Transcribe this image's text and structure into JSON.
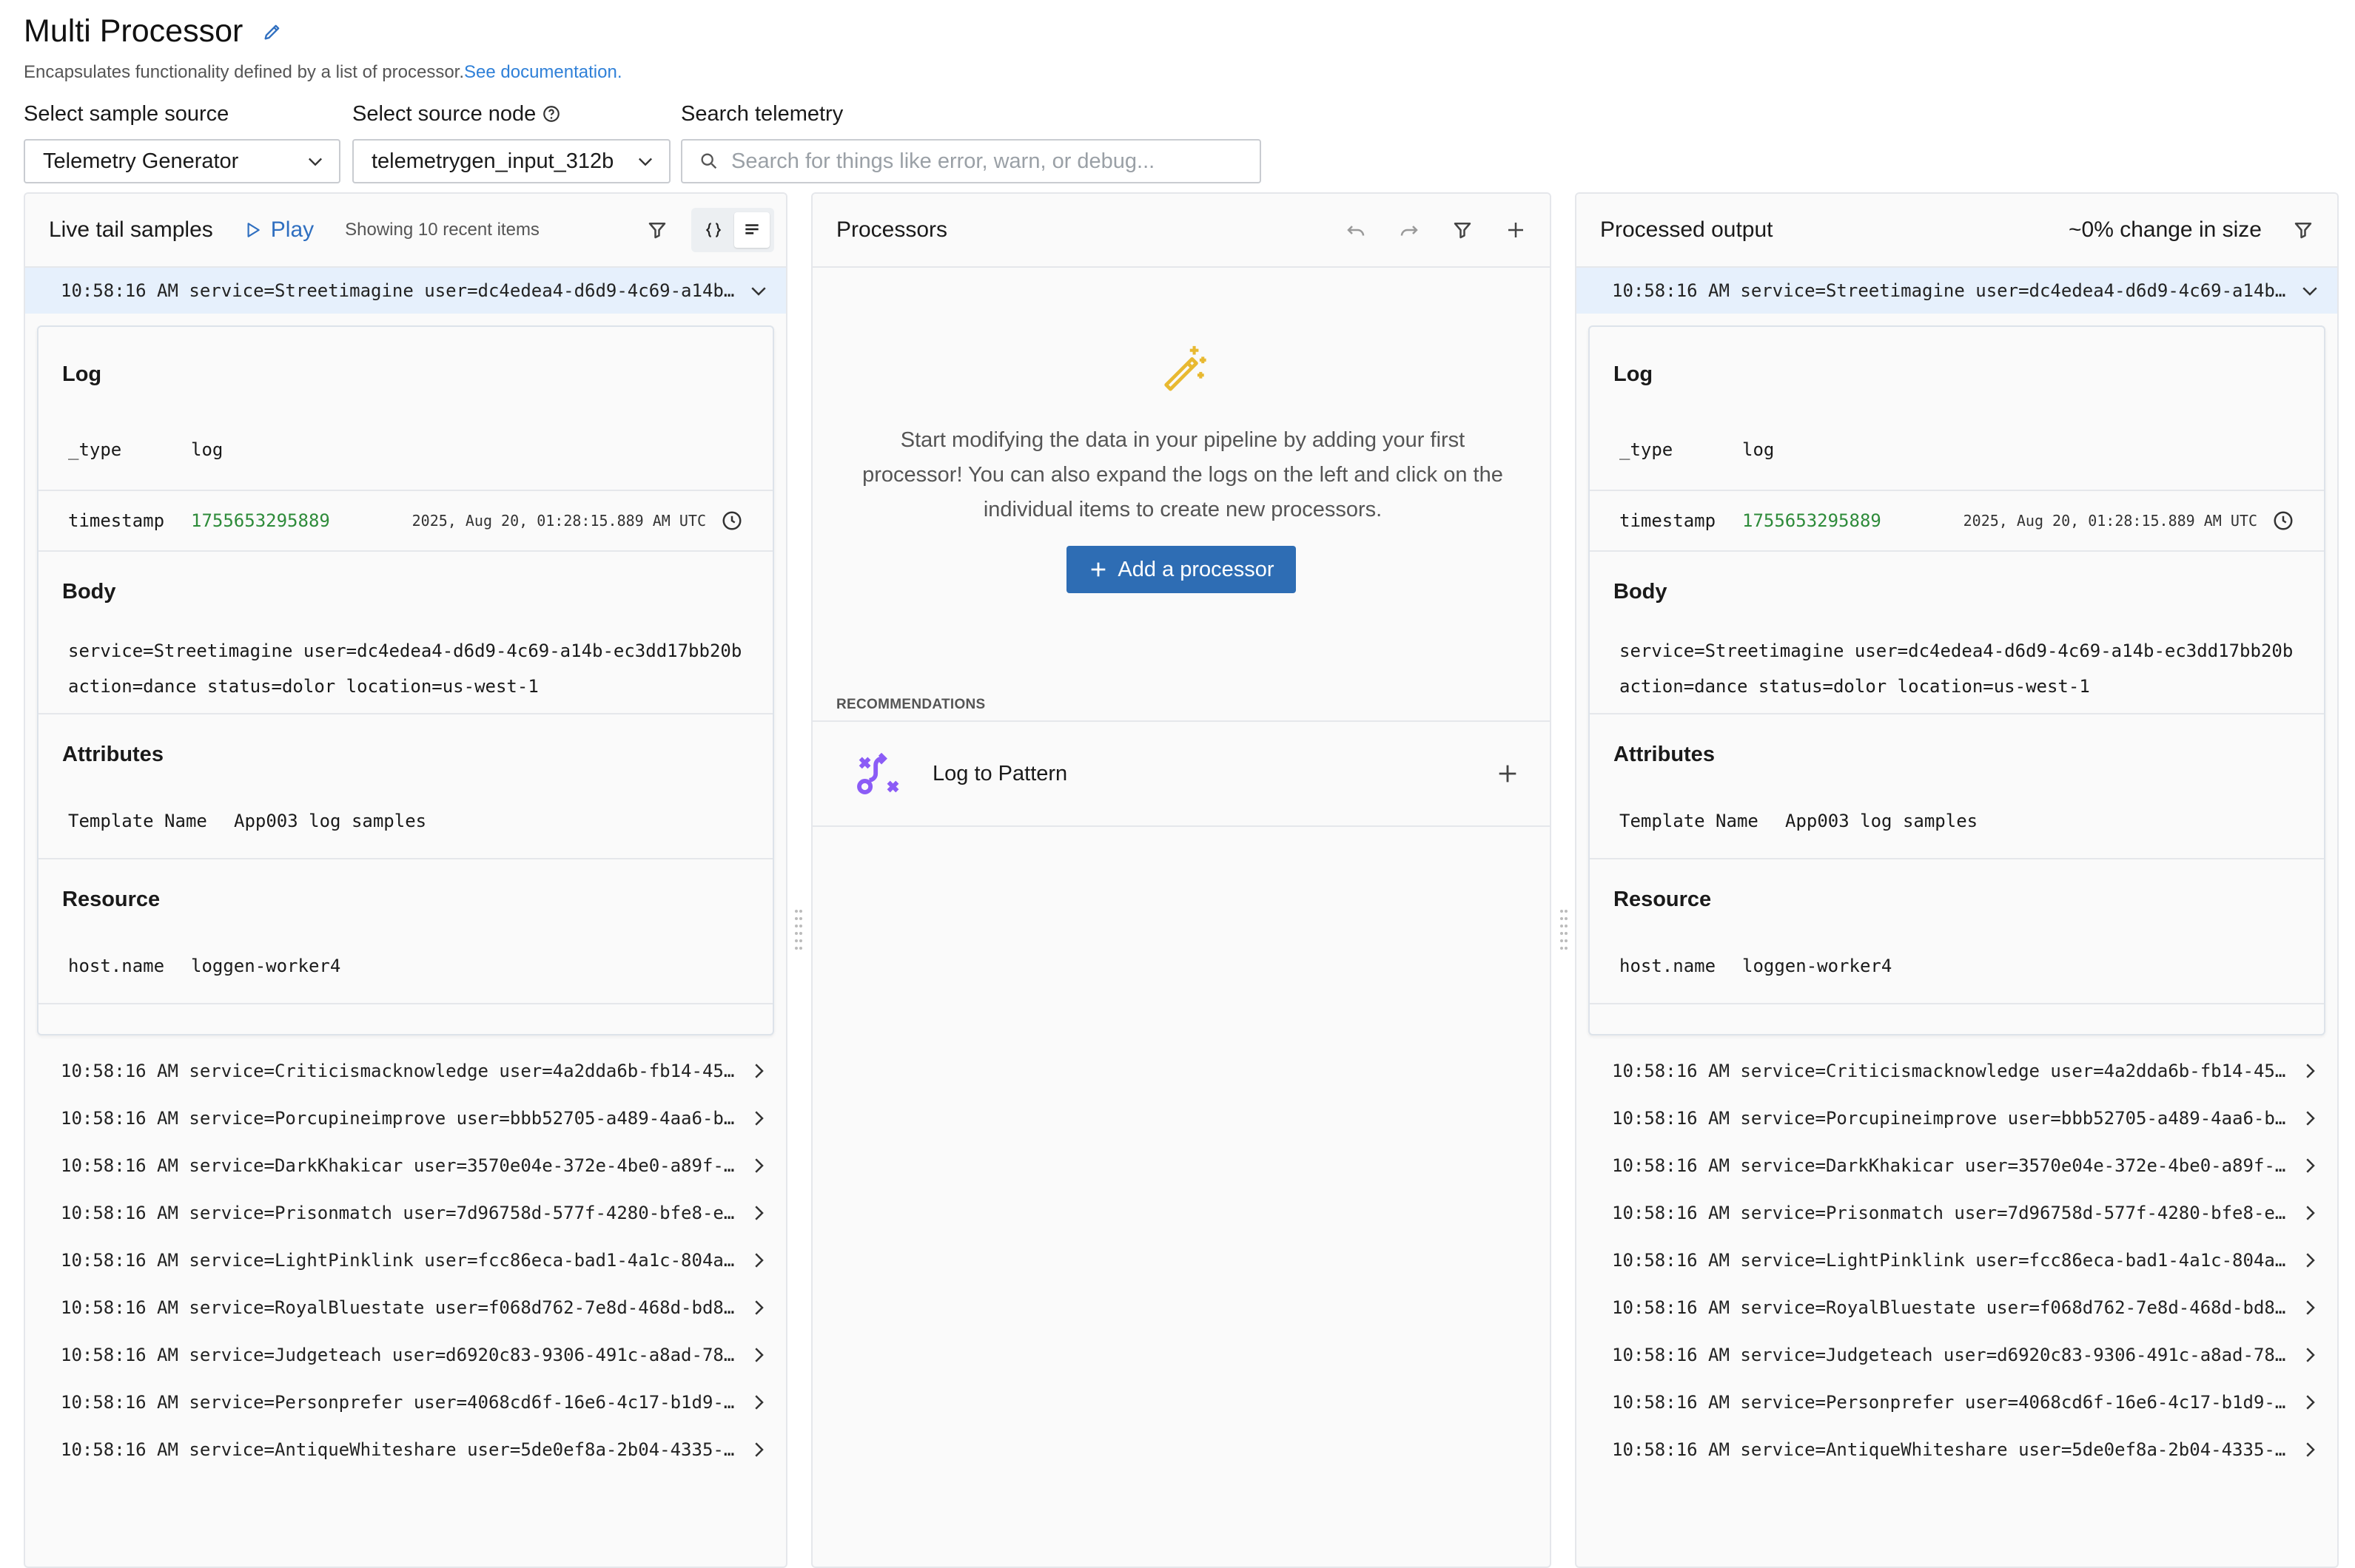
{
  "header": {
    "title": "Multi Processor",
    "description": "Encapsulates functionality defined by a list of processor.",
    "doc_link": "See documentation."
  },
  "controls": {
    "sample_source_label": "Select sample source",
    "sample_source_value": "Telemetry Generator",
    "source_node_label": "Select source node",
    "source_node_value": "telemetrygen_input_312b",
    "search_label": "Search telemetry",
    "search_placeholder": "Search for things like error, warn, or debug..."
  },
  "left_panel": {
    "title": "Live tail samples",
    "play_label": "Play",
    "showing": "Showing 10 recent items"
  },
  "middle_panel": {
    "title": "Processors",
    "empty_text": "Start modifying the data in your pipeline by adding your first processor! You can also expand the logs on the left and click on the individual items to create new processors.",
    "add_button": "Add a processor",
    "recommendations_label": "RECOMMENDATIONS",
    "recommendation_item": "Log to Pattern"
  },
  "right_panel": {
    "title": "Processed output",
    "change_label": "~0% change in size"
  },
  "detail": {
    "selected_row": "10:58:16 AM service=Streetimagine user=dc4edea4-d6d9-4c69-a14b…",
    "log_heading": "Log",
    "type_key": "_type",
    "type_value": "log",
    "timestamp_key": "timestamp",
    "timestamp_value": "1755653295889",
    "timestamp_date": "2025, Aug 20, 01:28:15.889 AM UTC",
    "body_heading": "Body",
    "body_line1": "service=Streetimagine user=dc4edea4-d6d9-4c69-a14b-ec3dd17bb20b",
    "body_line2": "action=dance status=dolor location=us-west-1",
    "attributes_heading": "Attributes",
    "attr_key": "Template Name",
    "attr_value": "App003 log samples",
    "resource_heading": "Resource",
    "res_key": "host.name",
    "res_value": "loggen-worker4"
  },
  "log_rows": [
    "10:58:16 AM service=Criticismacknowledge user=4a2dda6b-fb14-45…",
    "10:58:16 AM service=Porcupineimprove user=bbb52705-a489-4aa6-b…",
    "10:58:16 AM service=DarkKhakicar user=3570e04e-372e-4be0-a89f-…",
    "10:58:16 AM service=Prisonmatch user=7d96758d-577f-4280-bfe8-e…",
    "10:58:16 AM service=LightPinklink user=fcc86eca-bad1-4a1c-804a…",
    "10:58:16 AM service=RoyalBluestate user=f068d762-7e8d-468d-bd8…",
    "10:58:16 AM service=Judgeteach user=d6920c83-9306-491c-a8ad-78…",
    "10:58:16 AM service=Personprefer user=4068cd6f-16e6-4c17-b1d9-…",
    "10:58:16 AM service=AntiqueWhiteshare user=5de0ef8a-2b04-4335-…"
  ],
  "colors": {
    "accent": "#2e6db4",
    "selected_row": "#e6f0fc",
    "timestamp_green": "#2e8b3a",
    "recommendation_icon": "#8b5cf6",
    "wand_icon": "#e8b931"
  }
}
